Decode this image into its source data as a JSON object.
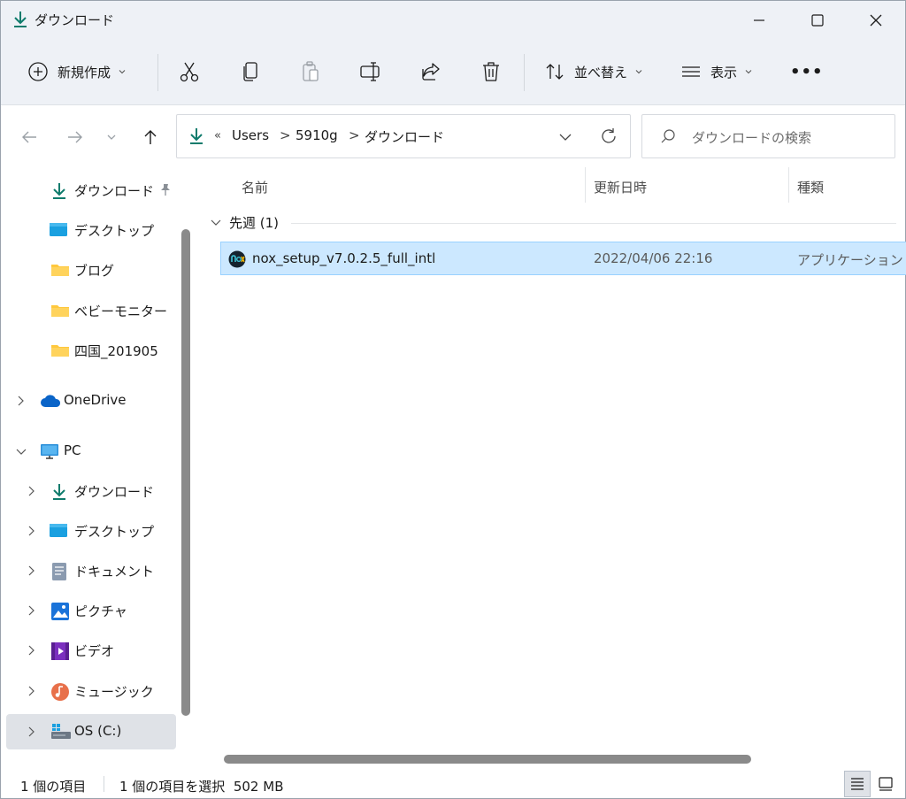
{
  "window": {
    "title": "ダウンロード",
    "controls": {
      "minimize": "minimize-icon",
      "maximize": "maximize-icon",
      "close": "close-icon"
    }
  },
  "toolbar": {
    "new_label": "新規作成",
    "sort_label": "並べ替え",
    "view_label": "表示",
    "more_label": "•••",
    "icons": [
      "cut-icon",
      "copy-icon",
      "paste-icon",
      "rename-icon",
      "share-icon",
      "delete-icon"
    ]
  },
  "address": {
    "overflow": "«",
    "segments": [
      "Users",
      "5910g",
      "ダウンロード"
    ],
    "separator": ">"
  },
  "search": {
    "placeholder": "ダウンロードの検索"
  },
  "sidebar": {
    "quick_access": [
      {
        "label": "ダウンロード",
        "icon": "download-icon",
        "pinned": true
      },
      {
        "label": "デスクトップ",
        "icon": "desktop-icon"
      },
      {
        "label": "ブログ",
        "icon": "folder-icon"
      },
      {
        "label": "ベビーモニター",
        "icon": "folder-icon"
      },
      {
        "label": "四国_201905",
        "icon": "folder-icon"
      }
    ],
    "onedrive": {
      "label": "OneDrive",
      "icon": "cloud-icon"
    },
    "pc": {
      "label": "PC",
      "icon": "monitor-icon"
    },
    "pc_items": [
      {
        "label": "ダウンロード",
        "icon": "download-icon"
      },
      {
        "label": "デスクトップ",
        "icon": "desktop-icon"
      },
      {
        "label": "ドキュメント",
        "icon": "document-icon"
      },
      {
        "label": "ピクチャ",
        "icon": "picture-icon"
      },
      {
        "label": "ビデオ",
        "icon": "video-icon"
      },
      {
        "label": "ミュージック",
        "icon": "music-icon"
      },
      {
        "label": "OS (C:)",
        "icon": "drive-icon"
      }
    ]
  },
  "columns": {
    "name": "名前",
    "modified": "更新日時",
    "type": "種類"
  },
  "group": {
    "label": "先週 (1)"
  },
  "files": [
    {
      "name": "nox_setup_v7.0.2.5_full_intl",
      "modified": "2022/04/06 22:16",
      "type": "アプリケーション",
      "selected": true
    }
  ],
  "status": {
    "item_count": "1 個の項目",
    "selection": "1 個の項目を選択  502 MB"
  },
  "colors": {
    "accent": "#0f7b0f",
    "selection_bg": "#cce8ff",
    "selection_border": "#99d1ff",
    "folder": "#ffd35c"
  }
}
